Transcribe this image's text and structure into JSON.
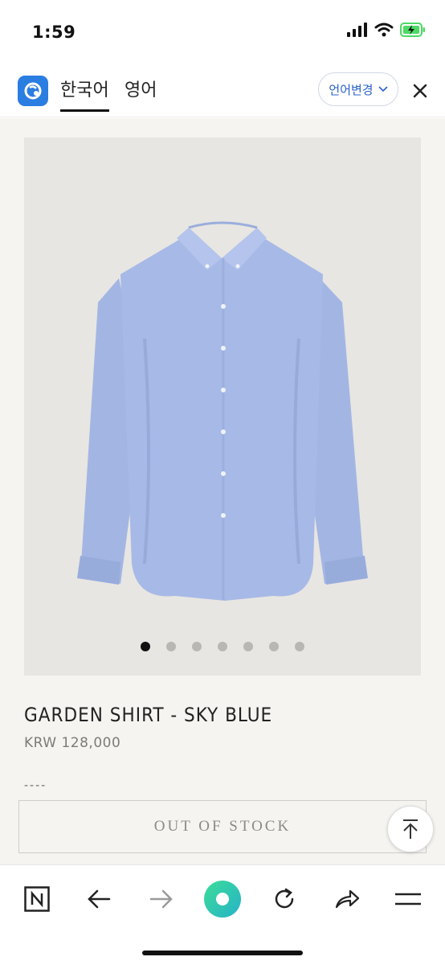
{
  "status_bar": {
    "time": "1:59"
  },
  "translate_bar": {
    "tabs": [
      {
        "label": "한국어",
        "active": true
      },
      {
        "label": "영어",
        "active": false
      }
    ],
    "change_language_label": "언어변경"
  },
  "gallery": {
    "total_images": 7,
    "current_index": 1
  },
  "product": {
    "title": "GARDEN SHIRT - SKY BLUE",
    "price": "KRW 128,000",
    "dashes": "----",
    "stock_status": "OUT OF STOCK"
  },
  "colors": {
    "shirt": "#a7b9e6",
    "papago_blue": "#2a7de1",
    "translate_green": "#3ecf8e",
    "battery_green": "#4cd964"
  },
  "toolbar": {
    "icons": [
      "naver-n-icon",
      "back-arrow-icon",
      "forward-arrow-icon",
      "translate-icon",
      "refresh-icon",
      "share-icon",
      "menu-icon"
    ]
  }
}
